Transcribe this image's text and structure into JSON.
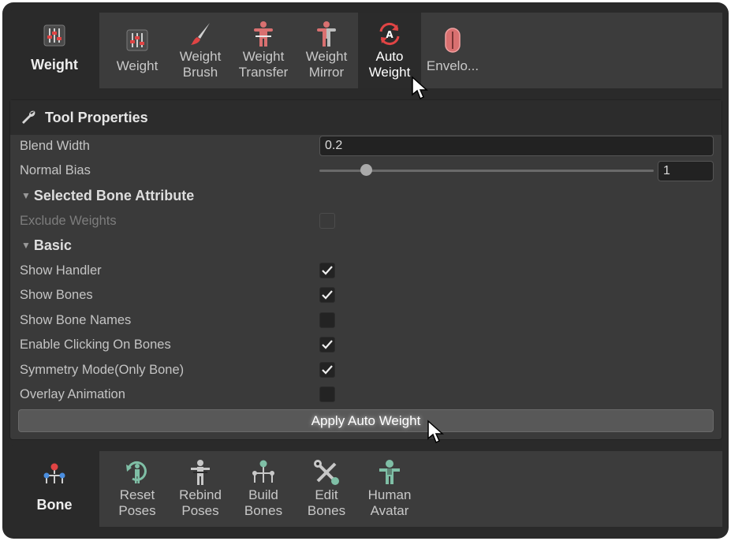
{
  "weight_panel": {
    "category_label": "Weight",
    "tools": [
      {
        "label": "Weight",
        "icon": "sliders-icon"
      },
      {
        "label": "Weight\nBrush",
        "icon": "brush-icon"
      },
      {
        "label": "Weight\nTransfer",
        "icon": "weight-transfer-icon"
      },
      {
        "label": "Weight\nMirror",
        "icon": "weight-mirror-icon"
      },
      {
        "label": "Auto\nWeight",
        "icon": "auto-weight-icon",
        "active": true
      },
      {
        "label": "Envelo...",
        "icon": "envelope-icon"
      }
    ]
  },
  "tool_properties": {
    "title": "Tool Properties",
    "blend_width": {
      "label": "Blend Width",
      "value": "0.2"
    },
    "normal_bias": {
      "label": "Normal Bias",
      "value": "1",
      "slider_fraction": 0.14
    },
    "selected_bone_section": "Selected Bone Attribute",
    "exclude_weights": {
      "label": "Exclude Weights",
      "checked": false,
      "disabled": true
    },
    "basic_section": "Basic",
    "options": [
      {
        "label": "Show Handler",
        "checked": true
      },
      {
        "label": "Show Bones",
        "checked": true
      },
      {
        "label": "Show Bone Names",
        "checked": false
      },
      {
        "label": "Enable Clicking On Bones",
        "checked": true
      },
      {
        "label": "Symmetry Mode(Only Bone)",
        "checked": true
      },
      {
        "label": "Overlay Animation",
        "checked": false
      }
    ],
    "apply_button": "Apply Auto Weight"
  },
  "bone_panel": {
    "category_label": "Bone",
    "tools": [
      {
        "label": "Reset\nPoses",
        "icon": "reset-poses-icon"
      },
      {
        "label": "Rebind\nPoses",
        "icon": "rebind-poses-icon"
      },
      {
        "label": "Build\nBones",
        "icon": "build-bones-icon"
      },
      {
        "label": "Edit\nBones",
        "icon": "edit-bones-icon"
      },
      {
        "label": "Human\nAvatar",
        "icon": "human-avatar-icon"
      }
    ]
  },
  "colors": {
    "accent_red": "#e04444",
    "bone_green": "#7fbfa6",
    "panel_bg": "#3a3a3a",
    "frame_bg": "#2a2a2a"
  }
}
